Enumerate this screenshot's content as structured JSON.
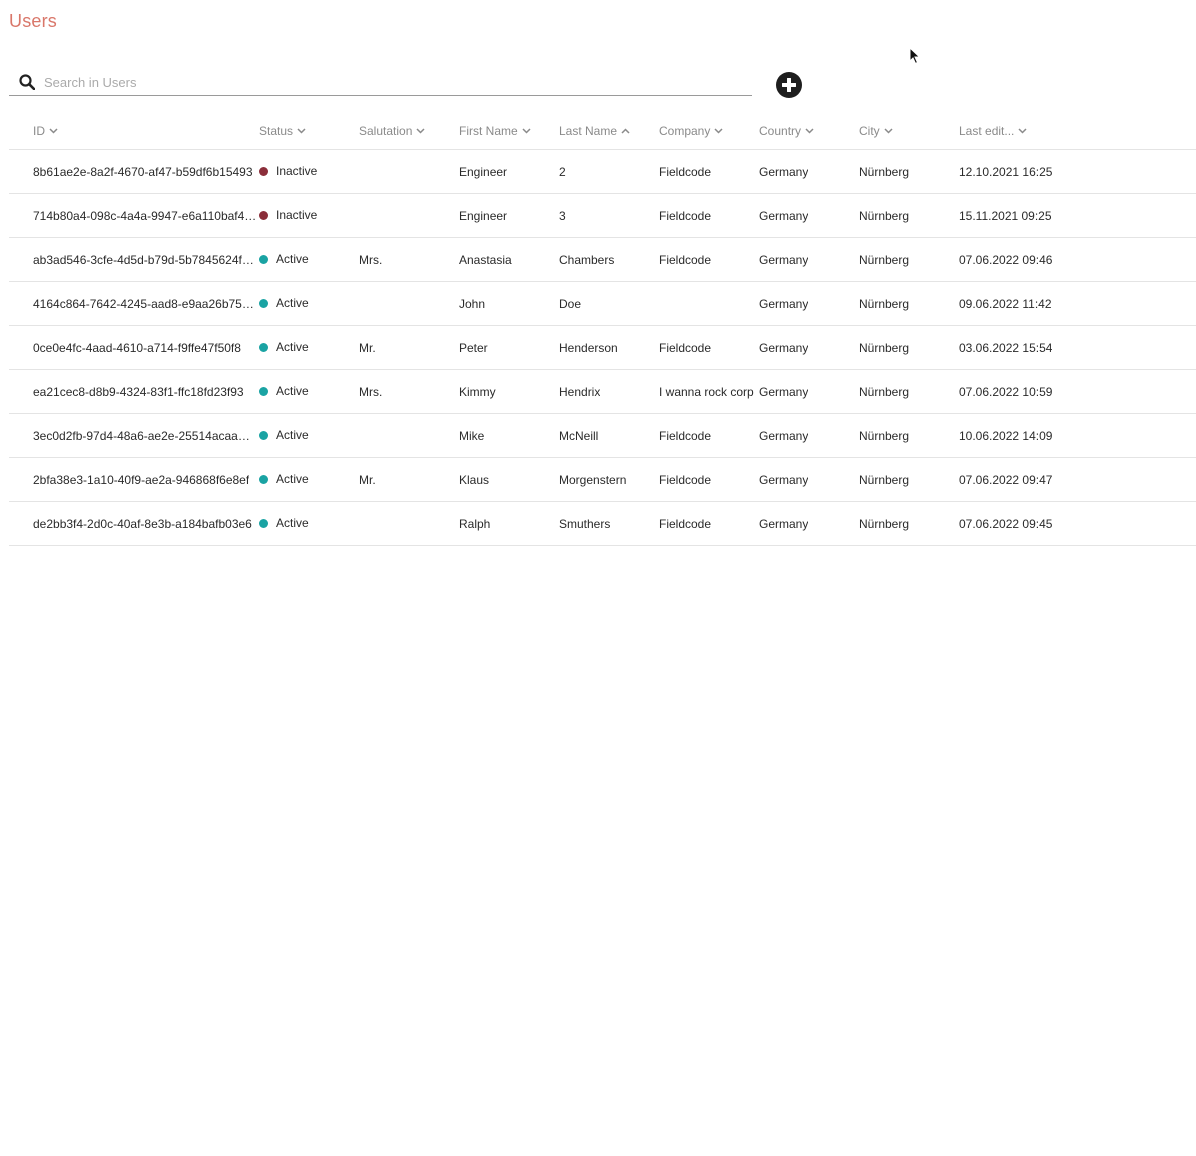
{
  "page": {
    "title": "Users"
  },
  "search": {
    "placeholder": "Search in Users",
    "value": ""
  },
  "colors": {
    "title": "#d9776a",
    "active": "#1aa3a3",
    "inactive": "#8b2e3a",
    "add_button": "#1e1e1e"
  },
  "icons": {
    "search": "search-icon",
    "add": "plus-circle-icon",
    "sort_desc": "chevron-down-icon",
    "sort_asc": "chevron-up-icon"
  },
  "table": {
    "columns": [
      {
        "label": "ID",
        "sort": "down"
      },
      {
        "label": "Status",
        "sort": "down"
      },
      {
        "label": "Salutation",
        "sort": "down"
      },
      {
        "label": "First Name",
        "sort": "down"
      },
      {
        "label": "Last Name",
        "sort": "up"
      },
      {
        "label": "Company",
        "sort": "down"
      },
      {
        "label": "Country",
        "sort": "down"
      },
      {
        "label": "City",
        "sort": "down"
      },
      {
        "label": "Last edit...",
        "sort": "down"
      }
    ],
    "rows": [
      {
        "id": "8b61ae2e-8a2f-4670-af47-b59df6b15493",
        "status": "Inactive",
        "salutation": "",
        "first_name": "Engineer",
        "last_name": "2",
        "company": "Fieldcode",
        "country": "Germany",
        "city": "Nürnberg",
        "last_edit": "12.10.2021 16:25"
      },
      {
        "id": "714b80a4-098c-4a4a-9947-e6a110baf4…",
        "status": "Inactive",
        "salutation": "",
        "first_name": "Engineer",
        "last_name": "3",
        "company": "Fieldcode",
        "country": "Germany",
        "city": "Nürnberg",
        "last_edit": "15.11.2021 09:25"
      },
      {
        "id": "ab3ad546-3cfe-4d5d-b79d-5b7845624f…",
        "status": "Active",
        "salutation": "Mrs.",
        "first_name": "Anastasia",
        "last_name": "Chambers",
        "company": "Fieldcode",
        "country": "Germany",
        "city": "Nürnberg",
        "last_edit": "07.06.2022 09:46"
      },
      {
        "id": "4164c864-7642-4245-aad8-e9aa26b75…",
        "status": "Active",
        "salutation": "",
        "first_name": "John",
        "last_name": "Doe",
        "company": "",
        "country": "Germany",
        "city": "Nürnberg",
        "last_edit": "09.06.2022 11:42"
      },
      {
        "id": "0ce0e4fc-4aad-4610-a714-f9ffe47f50f8",
        "status": "Active",
        "salutation": "Mr.",
        "first_name": "Peter",
        "last_name": "Henderson",
        "company": "Fieldcode",
        "country": "Germany",
        "city": "Nürnberg",
        "last_edit": "03.06.2022 15:54"
      },
      {
        "id": "ea21cec8-d8b9-4324-83f1-ffc18fd23f93",
        "status": "Active",
        "salutation": "Mrs.",
        "first_name": "Kimmy",
        "last_name": "Hendrix",
        "company": "I wanna rock corp",
        "country": "Germany",
        "city": "Nürnberg",
        "last_edit": "07.06.2022 10:59"
      },
      {
        "id": "3ec0d2fb-97d4-48a6-ae2e-25514acaa…",
        "status": "Active",
        "salutation": "",
        "first_name": "Mike",
        "last_name": "McNeill",
        "company": "Fieldcode",
        "country": "Germany",
        "city": "Nürnberg",
        "last_edit": "10.06.2022 14:09"
      },
      {
        "id": "2bfa38e3-1a10-40f9-ae2a-946868f6e8ef",
        "status": "Active",
        "salutation": "Mr.",
        "first_name": "Klaus",
        "last_name": "Morgenstern",
        "company": "Fieldcode",
        "country": "Germany",
        "city": "Nürnberg",
        "last_edit": "07.06.2022 09:47"
      },
      {
        "id": "de2bb3f4-2d0c-40af-8e3b-a184bafb03e6",
        "status": "Active",
        "salutation": "",
        "first_name": "Ralph",
        "last_name": "Smuthers",
        "company": "Fieldcode",
        "country": "Germany",
        "city": "Nürnberg",
        "last_edit": "07.06.2022 09:45"
      }
    ]
  }
}
